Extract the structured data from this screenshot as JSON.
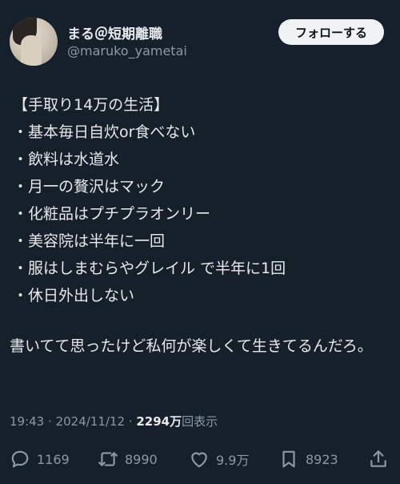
{
  "user": {
    "name": "まる＠短期離職",
    "handle": "@maruko_yametai"
  },
  "follow_label": "フォローする",
  "body_lines": [
    "【手取り14万の生活】",
    "・基本毎日自炊or食べない",
    "・飲料は水道水",
    "・月一の贅沢はマック",
    "・化粧品はプチプラオンリー",
    "・美容院は半年に一回",
    "・服はしまむらやグレイル で半年に1回",
    "・休日外出しない"
  ],
  "closing": "書いてて思ったけど私何が楽しくて生きてるんだろ。",
  "meta": {
    "time": "19:43",
    "date": "2024/11/12",
    "views": "2294万",
    "views_suffix": "回表示"
  },
  "actions": {
    "replies": "1169",
    "reposts": "8990",
    "likes": "9.9万",
    "bookmarks": "8923"
  },
  "icons": [
    "reply-icon",
    "repost-icon",
    "like-icon",
    "bookmark-icon",
    "share-icon"
  ],
  "colors": {
    "background": "#15202b",
    "text": "#e7e9ea",
    "muted": "#8b98a5",
    "button_bg": "#eff3f4"
  }
}
